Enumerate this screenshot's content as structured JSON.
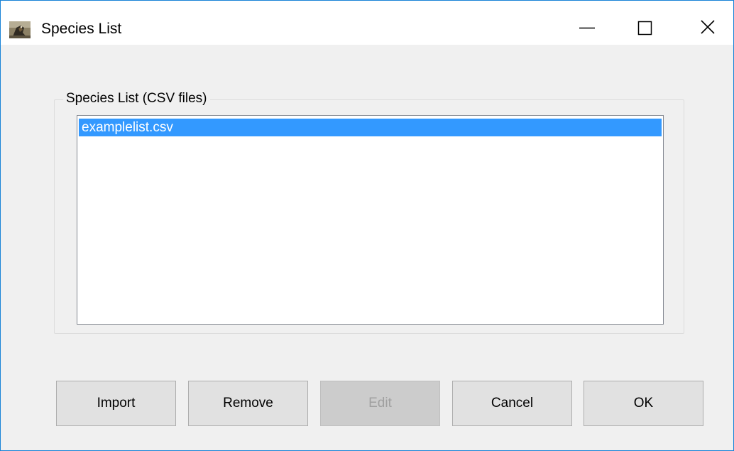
{
  "window": {
    "title": "Species List",
    "icon": "bird-photo-icon",
    "controls": {
      "minimize_icon": "minimize-icon",
      "maximize_icon": "maximize-icon",
      "close_icon": "close-icon"
    }
  },
  "group": {
    "label": "Species List (CSV files)"
  },
  "list": {
    "items": [
      {
        "label": "examplelist.csv",
        "selected": true
      }
    ]
  },
  "buttons": {
    "import": {
      "label": "Import",
      "enabled": true
    },
    "remove": {
      "label": "Remove",
      "enabled": true
    },
    "edit": {
      "label": "Edit",
      "enabled": false
    },
    "cancel": {
      "label": "Cancel",
      "enabled": true
    },
    "ok": {
      "label": "OK",
      "enabled": true
    }
  },
  "colors": {
    "window_border": "#1883d7",
    "dialog_background": "#f0f0f0",
    "selection": "#3399ff",
    "button_face": "#e1e1e1",
    "button_disabled_text": "#a0a0a0"
  }
}
